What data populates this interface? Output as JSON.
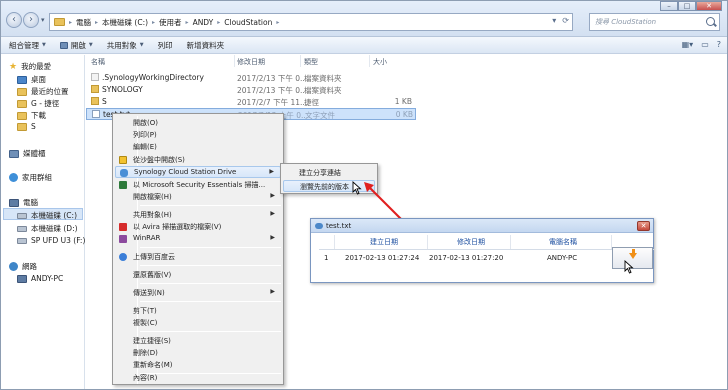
{
  "address": {
    "crumbs": [
      "電腦",
      "本機磁碟 (C:)",
      "使用者",
      "ANDY",
      "CloudStation"
    ],
    "search_placeholder": "搜尋 CloudStation"
  },
  "toolbar": {
    "organize": "組合管理",
    "open": "開啟",
    "share": "共用對象",
    "print": "列印",
    "new_folder": "新增資料夾"
  },
  "nav": {
    "favorites": "我的最愛",
    "desktop": "桌面",
    "recent": "最近的位置",
    "g_shortcut": "G - 捷徑",
    "downloads": "下載",
    "s": "S",
    "libraries": "媒體櫃",
    "homegroup": "家用群組",
    "computer": "電腦",
    "drive_c": "本機磁碟 (C:)",
    "drive_d": "本機磁碟 (D:)",
    "drive_f": "SP UFD U3 (F:)",
    "network": "網路",
    "andy_pc": "ANDY-PC"
  },
  "columns": {
    "name": "名稱",
    "date": "修改日期",
    "type": "類型",
    "size": "大小"
  },
  "files": [
    {
      "name": ".SynologyWorkingDirectory",
      "date": "2017/2/13 下午 0...",
      "type": "檔案資料夾",
      "size": ""
    },
    {
      "name": "SYNOLOGY",
      "date": "2017/2/13 下午 0...",
      "type": "檔案資料夾",
      "size": ""
    },
    {
      "name": "S",
      "date": "2017/2/7 下午 11...",
      "type": "捷徑",
      "size": "1 KB"
    },
    {
      "name": "test.txt",
      "date": "2017/2/13 上午 0...",
      "type": "文字文件",
      "size": "0 KB"
    }
  ],
  "context_menu": {
    "open": "開啟(O)",
    "print": "列印(P)",
    "edit": "編輯(E)",
    "sandbox": "從沙盤中開啟(S)",
    "synology": "Synology Cloud Station Drive",
    "mse": "以 Microsoft Security Essentials 掃描...",
    "open_with": "開啟檔案(H)",
    "share": "共用對象(H)",
    "avira": "以 Avira 掃描選取的檔案(V)",
    "winrar": "WinRAR",
    "upload": "上傳到百度云",
    "restore": "還原舊版(V)",
    "send_to": "傳送到(N)",
    "cut": "剪下(T)",
    "copy": "複製(C)",
    "shortcut": "建立捷徑(S)",
    "delete": "刪除(D)",
    "rename": "重新命名(M)",
    "properties": "內容(R)"
  },
  "submenu": {
    "create_link": "建立分享連結",
    "browse_versions": "瀏覽先前的版本"
  },
  "version_dialog": {
    "title": "test.txt",
    "headers": [
      "建立日期",
      "修改日期",
      "電腦名稱"
    ],
    "row": {
      "index": "1",
      "created": "2017-02-13 01:27:24",
      "modified": "2017-02-13 01:27:20",
      "computer": "ANDY-PC"
    }
  },
  "colors": {
    "accent_arrow": "#e02020",
    "download_arrow": "#f08f17"
  }
}
